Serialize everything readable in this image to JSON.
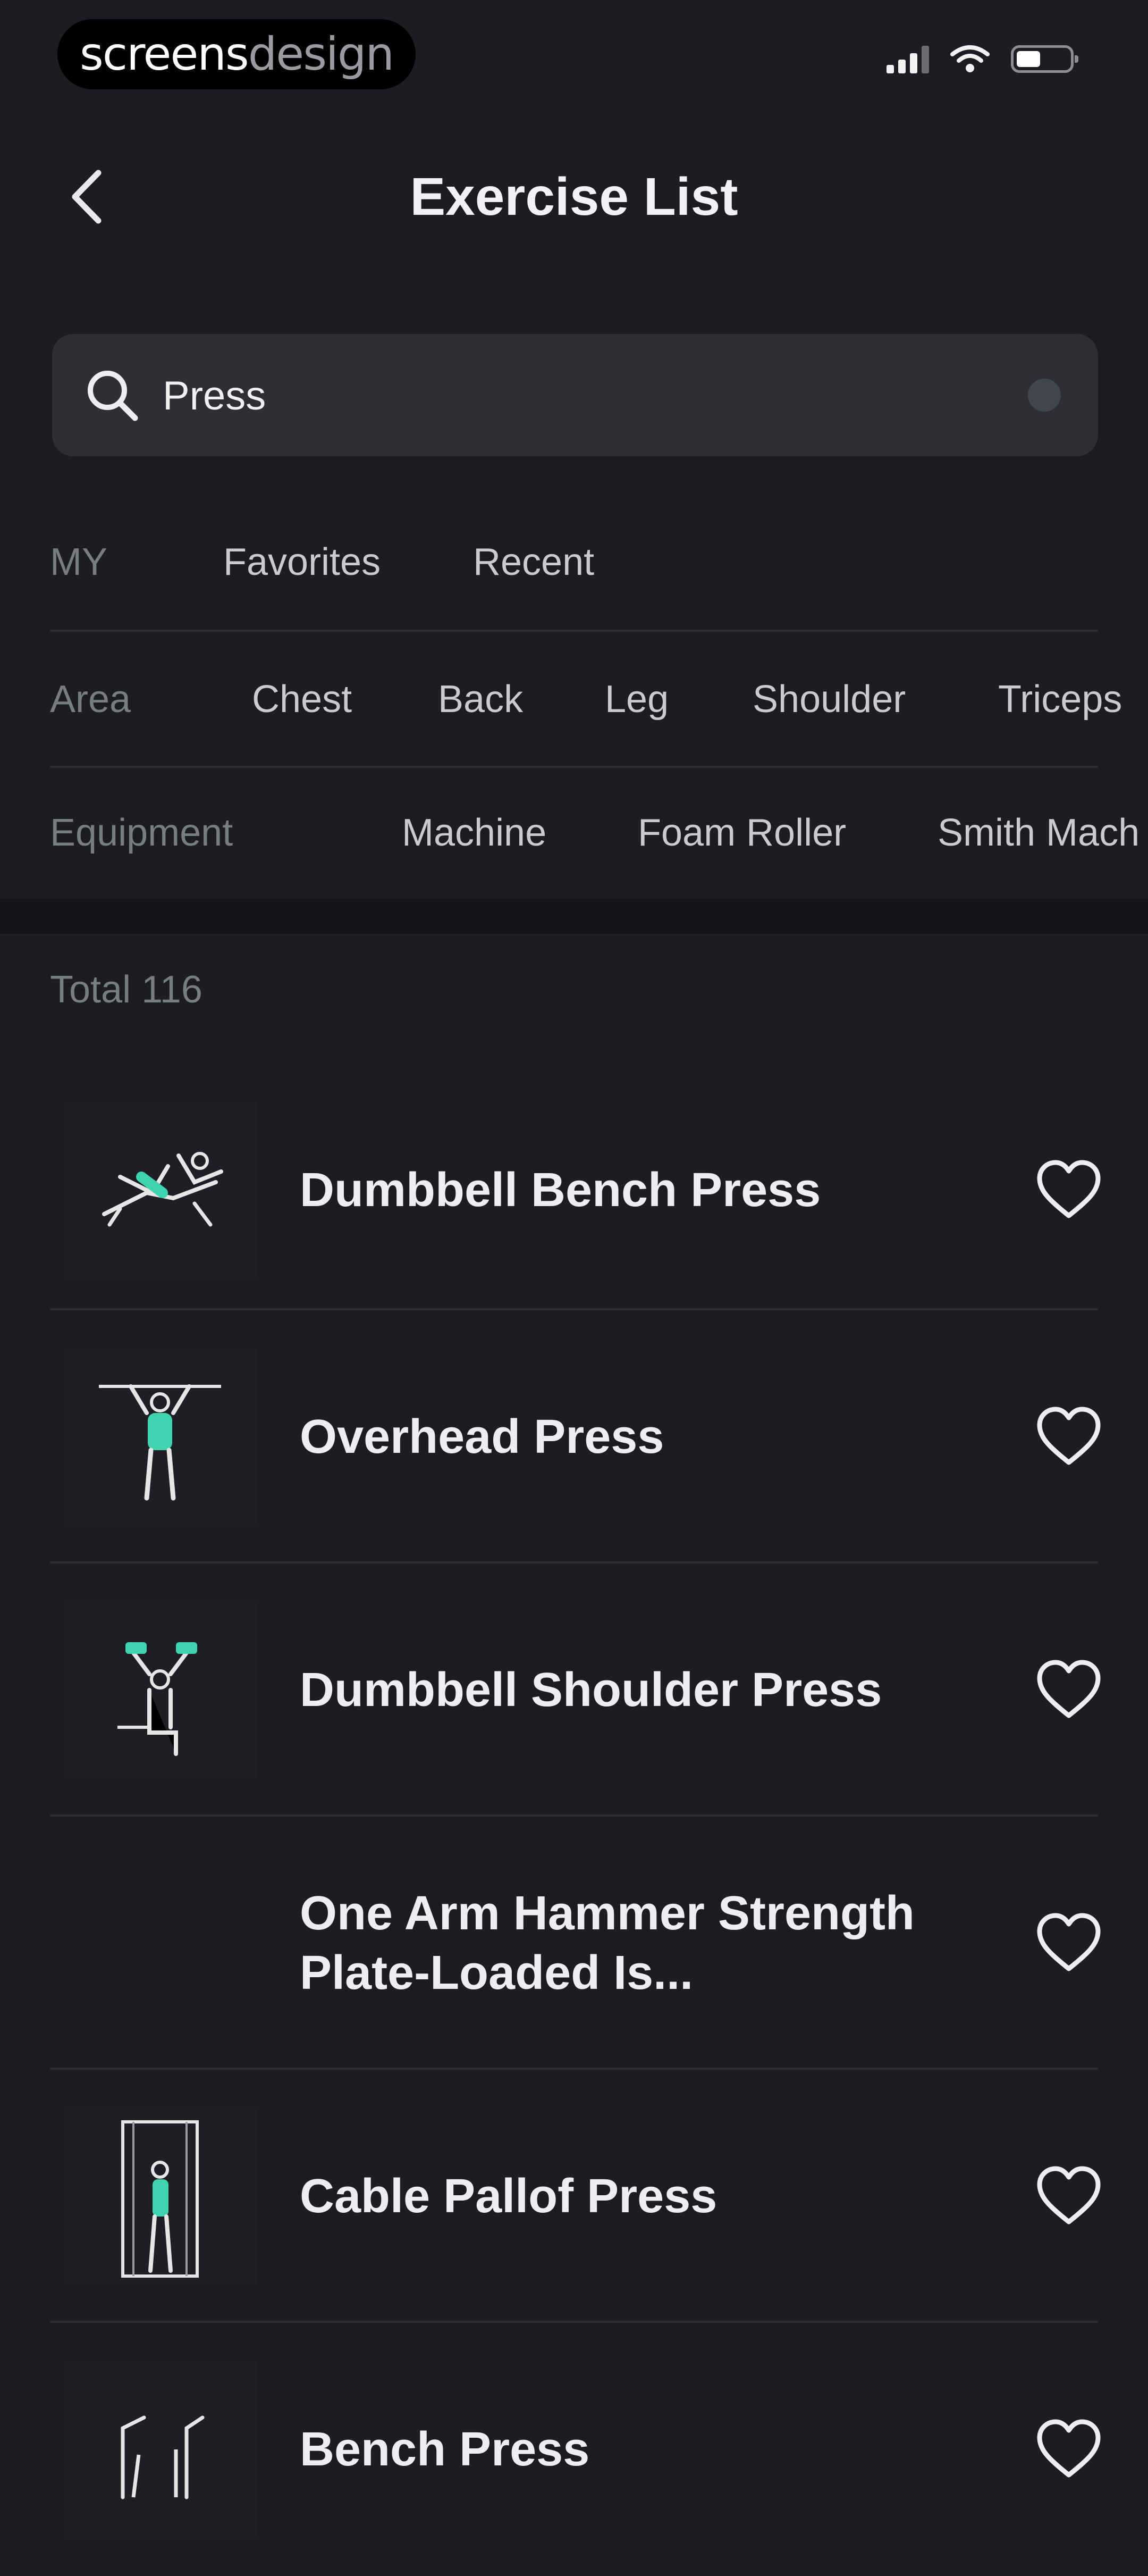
{
  "status_bar": {
    "watermark_bold": "screens",
    "watermark_light": "design"
  },
  "header": {
    "title": "Exercise List",
    "back_icon": "chevron-left-icon"
  },
  "search": {
    "value": "Press",
    "placeholder": "",
    "icon": "search-icon"
  },
  "filters": {
    "my": {
      "label": "MY",
      "options": [
        "Favorites",
        "Recent"
      ]
    },
    "area": {
      "label": "Area",
      "options": [
        "Chest",
        "Back",
        "Leg",
        "Shoulder",
        "Triceps"
      ]
    },
    "equipment": {
      "label": "Equipment",
      "options": [
        "Machine",
        "Foam Roller",
        "Smith Mach"
      ]
    }
  },
  "total": "Total 116",
  "exercises": [
    {
      "name": "Dumbbell Bench Press",
      "icon": "heart-icon"
    },
    {
      "name": "Overhead Press",
      "icon": "heart-icon"
    },
    {
      "name": "Dumbbell Shoulder Press",
      "icon": "heart-icon"
    },
    {
      "name": "One Arm Hammer Strength Plate-Loaded Is...",
      "icon": "heart-icon"
    },
    {
      "name": "Cable Pallof Press",
      "icon": "heart-icon"
    },
    {
      "name": "Bench Press",
      "icon": "heart-icon"
    }
  ],
  "colors": {
    "background": "#1c1d22",
    "accent": "#3fd3b0",
    "search_bg": "#2d2f35"
  }
}
